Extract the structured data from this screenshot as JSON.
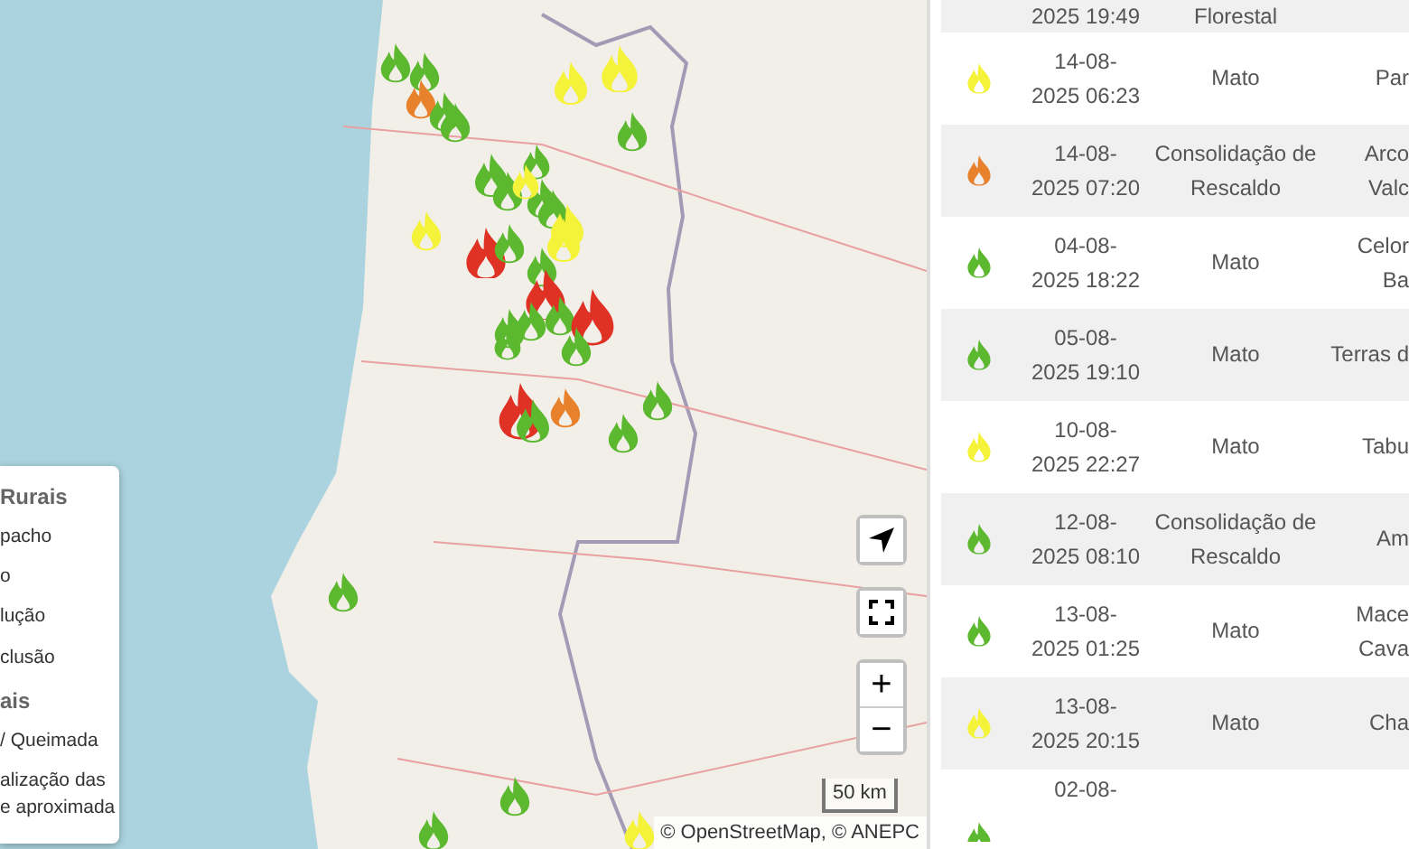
{
  "map": {
    "markers": [
      {
        "color": "#5cb82e"
      },
      {
        "color": "#5cb82e"
      },
      {
        "color": "#e8812b"
      },
      {
        "color": "#5cb82e"
      },
      {
        "color": "#5cb82e"
      },
      {
        "color": "#f5f23a"
      },
      {
        "color": "#f5f23a"
      },
      {
        "color": "#5cb82e"
      },
      {
        "color": "#5cb82e"
      },
      {
        "color": "#5cb82e"
      },
      {
        "color": "#f5f23a"
      },
      {
        "color": "#5cb82e"
      },
      {
        "color": "#5cb82e"
      },
      {
        "color": "#5cb82e"
      },
      {
        "color": "#f5f23a"
      },
      {
        "color": "#f5f23a"
      },
      {
        "color": "#e03125"
      },
      {
        "color": "#5cb82e"
      },
      {
        "color": "#f5f23a"
      },
      {
        "color": "#5cb82e"
      },
      {
        "color": "#e03125"
      },
      {
        "color": "#5cb82e"
      },
      {
        "color": "#e03125"
      },
      {
        "color": "#5cb82e"
      },
      {
        "color": "#5cb82e"
      },
      {
        "color": "#5cb82e"
      },
      {
        "color": "#5cb82e"
      },
      {
        "color": "#e03125"
      },
      {
        "color": "#5cb82e"
      },
      {
        "color": "#e8812b"
      },
      {
        "color": "#5cb82e"
      },
      {
        "color": "#5cb82e"
      },
      {
        "color": "#5cb82e"
      },
      {
        "color": "#5cb82e"
      },
      {
        "color": "#5cb82e"
      },
      {
        "color": "#f5f23a"
      }
    ],
    "legend": [
      {
        "title": "Rurais",
        "items": [
          "pacho",
          "o",
          "lução",
          "clusão"
        ]
      },
      {
        "title": "ais",
        "items": [
          "/ Queimada",
          "alização das\ne aproximada"
        ]
      }
    ],
    "zoom_in": "+",
    "zoom_out": "−",
    "scale": "50 km",
    "attribution": "© OpenStreetMap, © ANEPC"
  },
  "table": {
    "rows": [
      {
        "date_lines": [
          "2025 19:49"
        ],
        "type_lines": [
          "Florestal"
        ],
        "location_lines": []
      },
      {
        "color": "#f5f23a",
        "date_lines": [
          "14-08-",
          "2025 06:23"
        ],
        "type_lines": [
          "Mato"
        ],
        "location_lines": [
          "Par"
        ]
      },
      {
        "color": "#e8812b",
        "date_lines": [
          "14-08-",
          "2025 07:20"
        ],
        "type_lines": [
          "Consolidação de",
          "Rescaldo"
        ],
        "location_lines": [
          "Arco",
          "Valc"
        ]
      },
      {
        "color": "#5cb82e",
        "date_lines": [
          "04-08-",
          "2025 18:22"
        ],
        "type_lines": [
          "Mato"
        ],
        "location_lines": [
          "Celor",
          "Ba"
        ]
      },
      {
        "color": "#5cb82e",
        "date_lines": [
          "05-08-",
          "2025 19:10"
        ],
        "type_lines": [
          "Mato"
        ],
        "location_lines": [
          "Terras d"
        ]
      },
      {
        "color": "#f5f23a",
        "date_lines": [
          "10-08-",
          "2025 22:27"
        ],
        "type_lines": [
          "Mato"
        ],
        "location_lines": [
          "Tabu"
        ]
      },
      {
        "color": "#5cb82e",
        "date_lines": [
          "12-08-",
          "2025 08:10"
        ],
        "type_lines": [
          "Consolidação de",
          "Rescaldo"
        ],
        "location_lines": [
          "Am"
        ]
      },
      {
        "color": "#5cb82e",
        "date_lines": [
          "13-08-",
          "2025 01:25"
        ],
        "type_lines": [
          "Mato"
        ],
        "location_lines": [
          "Mace",
          "Cava"
        ]
      },
      {
        "color": "#f5f23a",
        "date_lines": [
          "13-08-",
          "2025 20:15"
        ],
        "type_lines": [
          "Mato"
        ],
        "location_lines": [
          "Cha"
        ]
      },
      {
        "color": "#5cb82e",
        "date_lines": [
          "02-08-"
        ],
        "type_lines": [],
        "location_lines": []
      }
    ]
  }
}
